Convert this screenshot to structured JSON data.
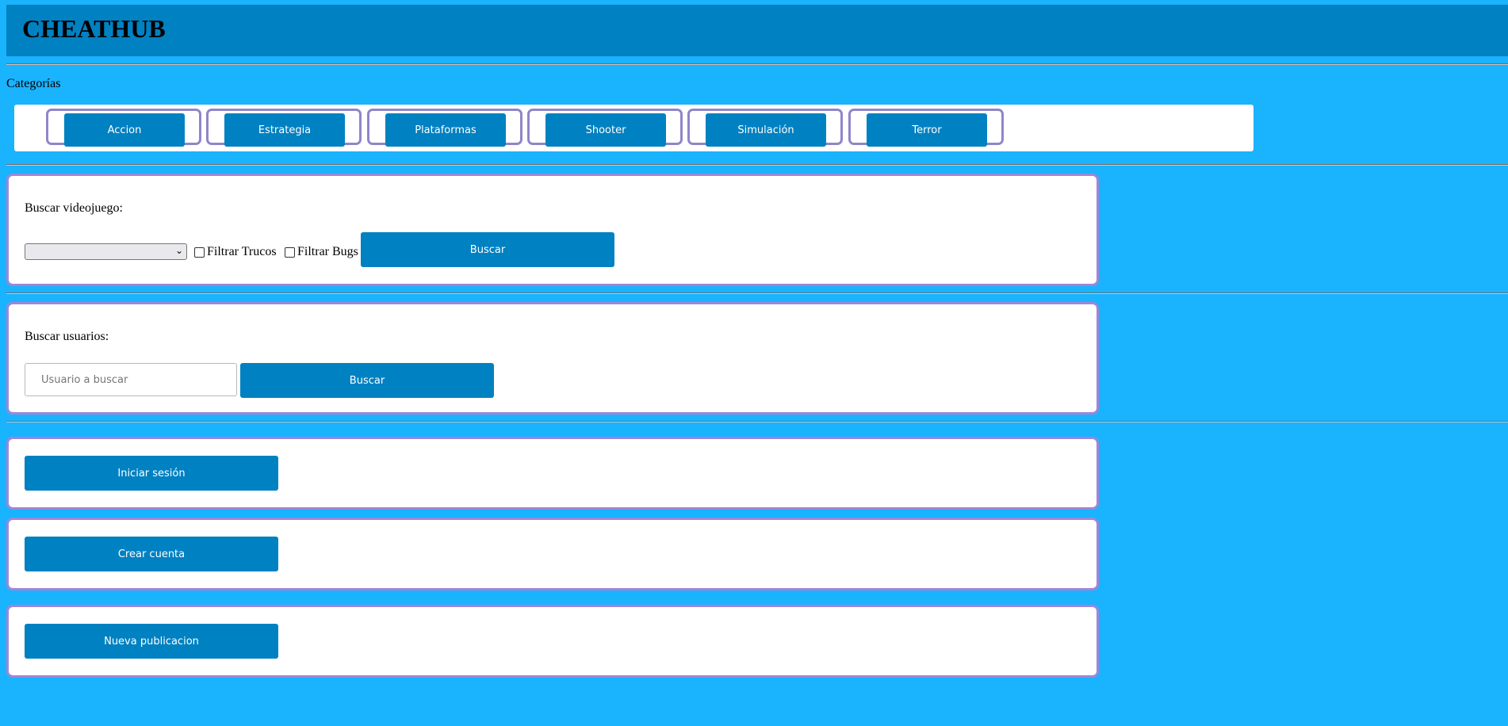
{
  "header": {
    "title": "CHEATHUB"
  },
  "categories": {
    "label": "Categorías",
    "items": [
      "Accion",
      "Estrategia",
      "Plataformas",
      "Shooter",
      "Simulación",
      "Terror"
    ]
  },
  "game_search": {
    "title": "Buscar videojuego:",
    "select_value": "",
    "filter_tricks_label": "Filtrar Trucos",
    "filter_bugs_label": "Filtrar Bugs",
    "search_label": "Buscar"
  },
  "user_search": {
    "title": "Buscar usuarios:",
    "placeholder": "Usuario a buscar",
    "search_label": "Buscar"
  },
  "actions": {
    "login_label": "Iniciar sesión",
    "create_account_label": "Crear cuenta",
    "new_post_label": "Nueva publicacion"
  },
  "colors": {
    "background": "#1ab3fe",
    "header": "#0081c2",
    "button": "#0081c2",
    "panel_border": "#9f86d8"
  }
}
